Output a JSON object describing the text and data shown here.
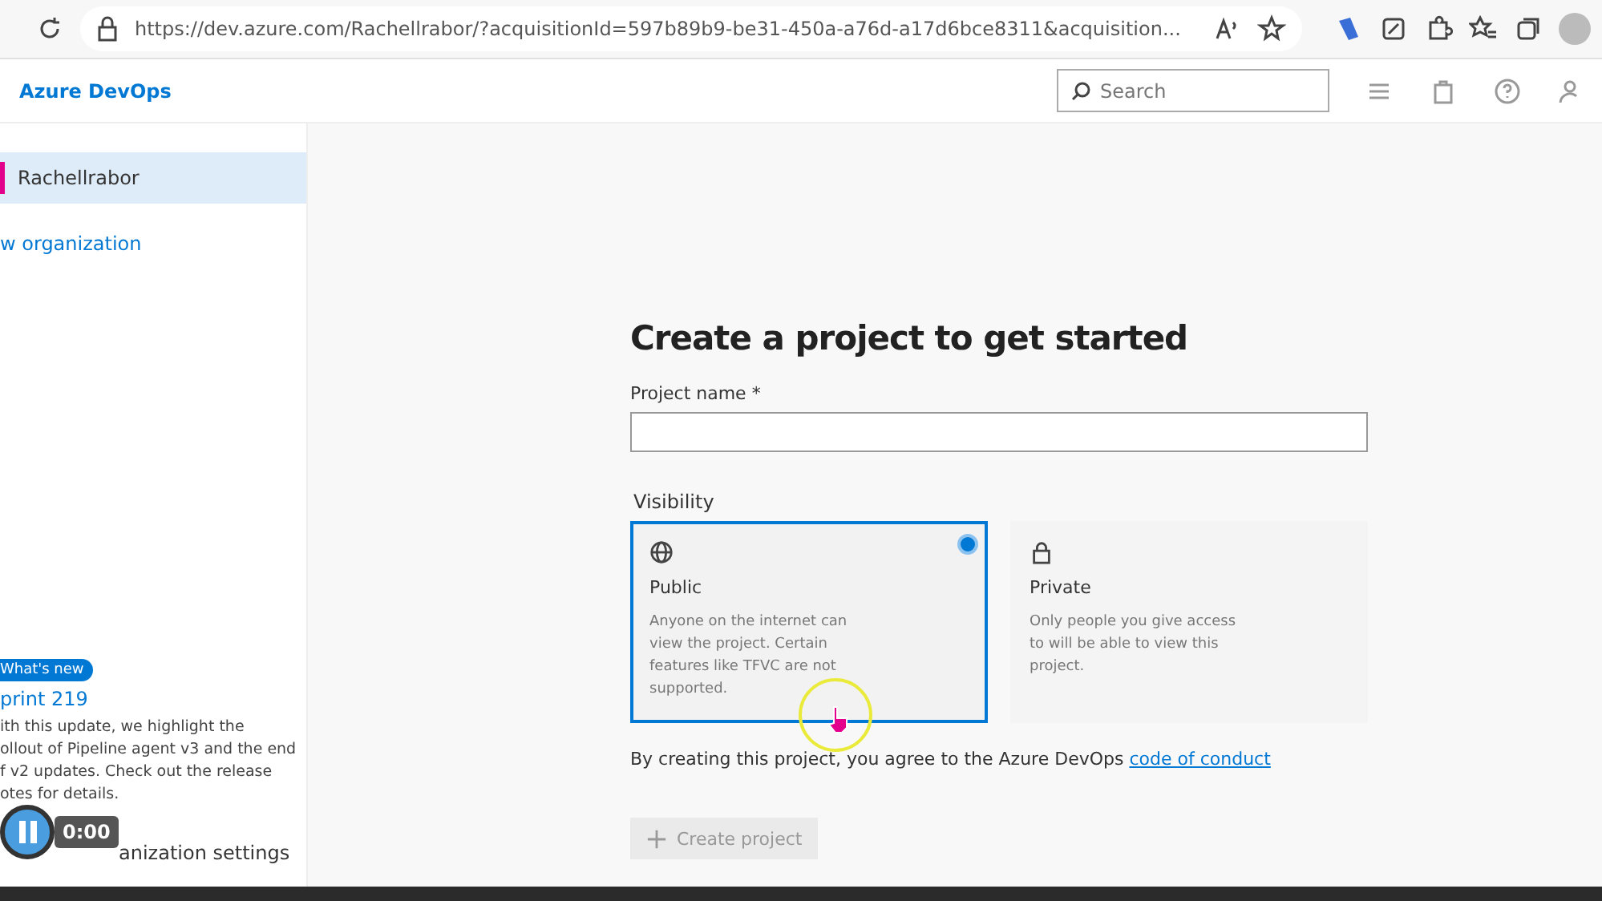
{
  "browser": {
    "url": "https://dev.azure.com/Rachellrabor/?acquisitionId=597b89b9-be31-450a-a76d-a17d6bce8311&acquisition..."
  },
  "header": {
    "brand": "Azure DevOps",
    "search": {
      "placeholder": "Search"
    }
  },
  "sidebar": {
    "organizations": [
      {
        "name": "Rachellrabor",
        "selected": true,
        "color": "#e3008c"
      }
    ],
    "new_organization": "w organization",
    "whats_new": {
      "badge": "What's new",
      "title": "print 219",
      "lines": [
        "ith this update, we highlight the",
        "ollout of Pipeline agent v3 and the end",
        "f v2 updates. Check out the release",
        "otes for details."
      ]
    },
    "settings": "anization settings"
  },
  "video": {
    "time": "0:00",
    "playing": true
  },
  "form": {
    "title": "Create a project to get started",
    "project_name": {
      "label": "Project name *"
    },
    "visibility_label": "Visibility",
    "options": [
      {
        "kind": "public",
        "title": "Public",
        "description": "Anyone on the internet can view the project. Certain features like TFVC are not supported.",
        "selected": true
      },
      {
        "kind": "private",
        "title": "Private",
        "description": "Only people you give access to will be able to view this project.",
        "selected": false
      }
    ],
    "agreement": "By creating this project, you agree to the Azure DevOps",
    "agreement_link": "code of conduct",
    "create_button": {
      "label": "Create project",
      "disabled": true
    }
  }
}
